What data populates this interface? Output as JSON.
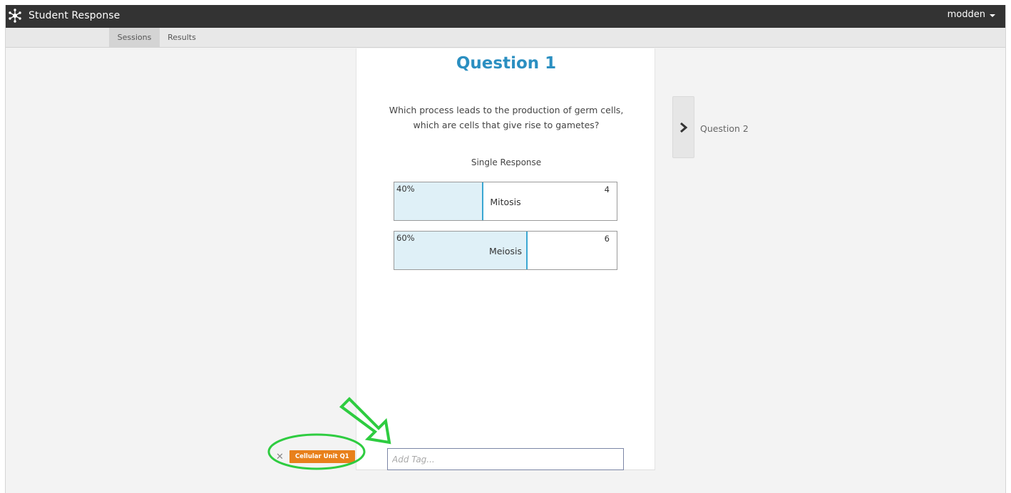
{
  "header": {
    "app_title": "Student Response",
    "logo_icon": "atom-network-icon",
    "user_name": "modden"
  },
  "subnav": {
    "tabs": [
      {
        "label": "Sessions",
        "active": true
      },
      {
        "label": "Results",
        "active": false
      }
    ]
  },
  "question": {
    "title": "Question 1",
    "text_line1": "Which process leads to the production of germ cells,",
    "text_line2": "which are cells that give rise to gametes?",
    "type": "Single Response",
    "answers": [
      {
        "label": "Mitosis",
        "percent": "40%",
        "count": "4",
        "fraction": 0.4
      },
      {
        "label": "Meiosis",
        "percent": "60%",
        "count": "6",
        "fraction": 0.6
      }
    ]
  },
  "next": {
    "label": "Question 2",
    "icon": "chevron-right-icon"
  },
  "tags": {
    "input_placeholder": "Add Tag...",
    "items": [
      {
        "label": "Cellular Unit Q1",
        "remove_icon": "close-icon",
        "color": "#e8801b"
      }
    ]
  },
  "colors": {
    "topbar": "#333333",
    "title_blue": "#2b8fc1",
    "bar_fill": "#dff0f7",
    "bar_edge": "#3aa7d2",
    "annotation_green": "#2ecc40"
  }
}
